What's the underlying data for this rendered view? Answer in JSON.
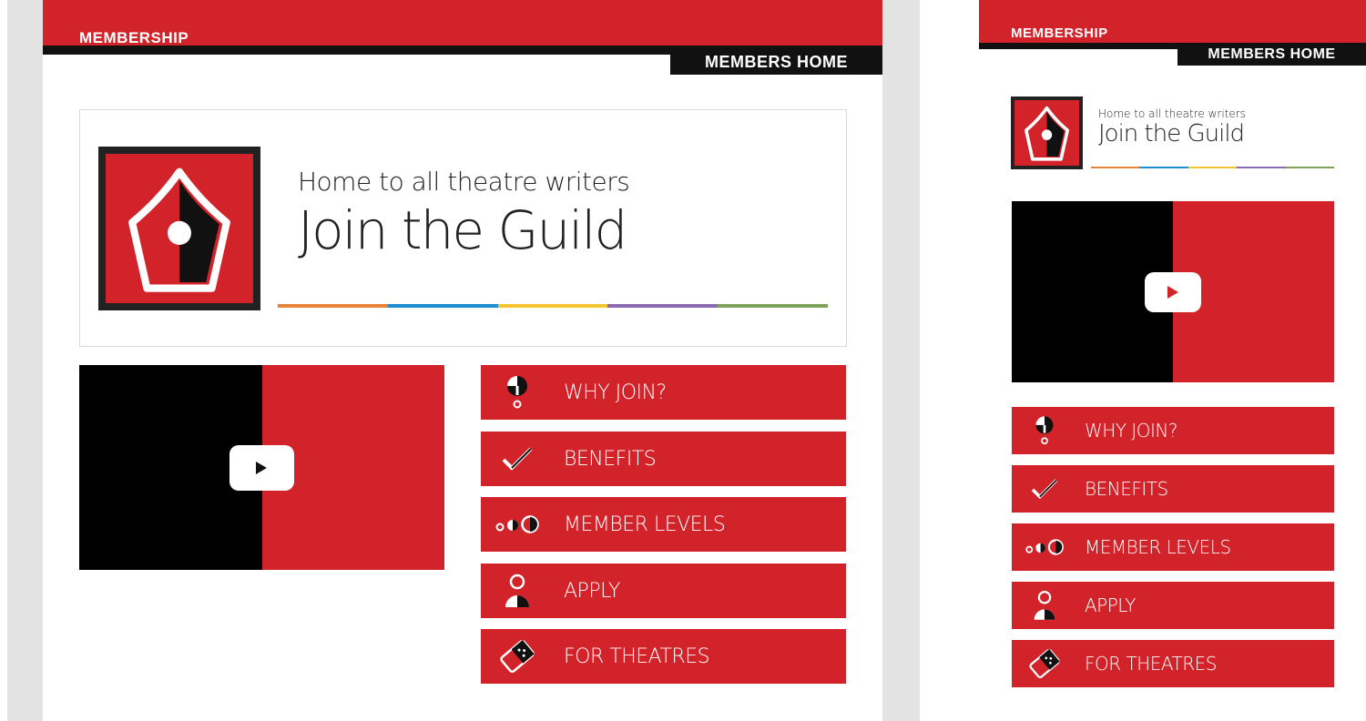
{
  "colors": {
    "accent_red": "#d2232a",
    "black": "#111111",
    "stripe": [
      "#e8833a",
      "#1f8dcf",
      "#f2c531",
      "#8a6bb0",
      "#7ea35a"
    ]
  },
  "desktop": {
    "section_label": "MEMBERSHIP",
    "members_home_label": "MEMBERS HOME",
    "banner": {
      "tagline": "Home to all theatre writers",
      "headline": "Join the Guild"
    },
    "video": {
      "play_icon": "play-icon"
    },
    "menu": [
      {
        "label": "WHY JOIN?",
        "icon": "question-icon"
      },
      {
        "label": "BENEFITS",
        "icon": "checkmark-icon"
      },
      {
        "label": "MEMBER LEVELS",
        "icon": "levels-icon"
      },
      {
        "label": "APPLY",
        "icon": "person-icon"
      },
      {
        "label": "FOR THEATRES",
        "icon": "ticket-icon"
      }
    ]
  },
  "mobile": {
    "section_label": "MEMBERSHIP",
    "members_home_label": "MEMBERS HOME",
    "banner": {
      "tagline": "Home to all theatre writers",
      "headline": "Join the Guild"
    },
    "video": {
      "play_icon": "play-icon"
    },
    "menu": [
      {
        "label": "WHY JOIN?",
        "icon": "question-icon"
      },
      {
        "label": "BENEFITS",
        "icon": "checkmark-icon"
      },
      {
        "label": "MEMBER LEVELS",
        "icon": "levels-icon"
      },
      {
        "label": "APPLY",
        "icon": "person-icon"
      },
      {
        "label": "FOR THEATRES",
        "icon": "ticket-icon"
      }
    ]
  }
}
